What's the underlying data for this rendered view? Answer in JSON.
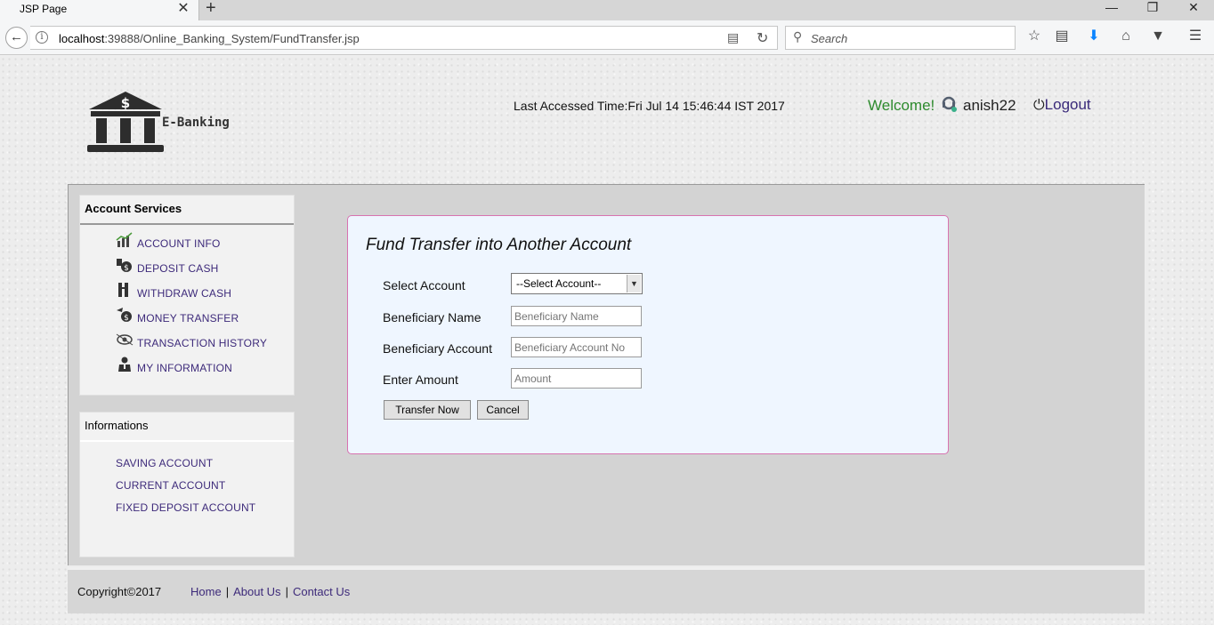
{
  "browser": {
    "tab_title": "JSP Page",
    "tab_close": "✕",
    "new_tab": "+",
    "url_host": "localhost",
    "url_rest": ":39888/Online_Banking_System/FundTransfer.jsp",
    "search_placeholder": "Search",
    "window_controls": [
      "—",
      "❐",
      "✕"
    ]
  },
  "header": {
    "logo_text": "E-Banking",
    "last_accessed": "Last Accessed Time:Fri Jul 14 15:46:44 IST 2017",
    "welcome": "Welcome!",
    "username": "anish22",
    "logout": "Logout"
  },
  "sidebar": {
    "services_title": "Account Services",
    "services": [
      {
        "label": "ACCOUNT INFO",
        "icon": "chart-icon"
      },
      {
        "label": "DEPOSIT CASH",
        "icon": "deposit-icon"
      },
      {
        "label": "WITHDRAW CASH",
        "icon": "withdraw-icon"
      },
      {
        "label": "MONEY TRANSFER",
        "icon": "money-transfer-icon"
      },
      {
        "label": "TRANSACTION HISTORY",
        "icon": "history-icon"
      },
      {
        "label": "MY INFORMATION",
        "icon": "person-icon"
      }
    ],
    "info_title": "Informations",
    "info_items": [
      "SAVING ACCOUNT",
      "CURRENT ACCOUNT",
      "FIXED DEPOSIT ACCOUNT"
    ]
  },
  "form": {
    "title": "Fund Transfer into Another Account",
    "select_label": "Select Account",
    "select_value": "--Select Account--",
    "beneficiary_name_label": "Beneficiary Name",
    "beneficiary_name_placeholder": "Beneficiary Name",
    "beneficiary_account_label": "Beneficiary Account",
    "beneficiary_account_placeholder": "Beneficiary Account No",
    "amount_label": "Enter Amount",
    "amount_placeholder": "Amount",
    "submit_label": "Transfer Now",
    "cancel_label": "Cancel"
  },
  "footer": {
    "copyright": "Copyright©2017",
    "links": [
      "Home",
      "About Us",
      "Contact Us"
    ],
    "separator": "|"
  }
}
